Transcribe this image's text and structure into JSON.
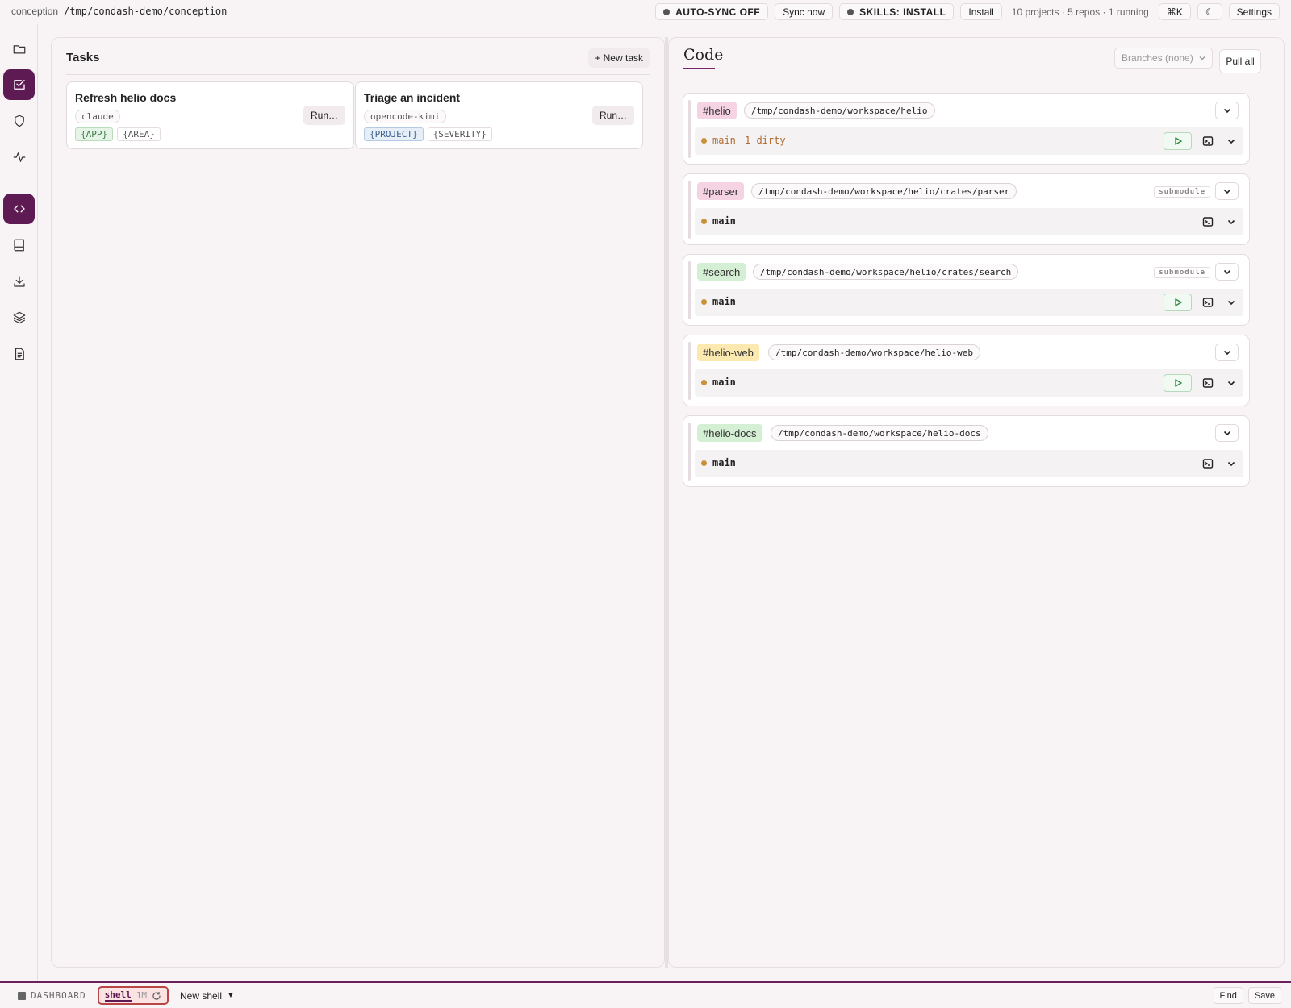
{
  "topbar": {
    "workspace_name": "conception",
    "workspace_path": "/tmp/condash-demo/conception",
    "auto_sync": "AUTO-SYNC OFF",
    "sync_now": "Sync now",
    "skills": "SKILLS: INSTALL",
    "install": "Install",
    "summary": "10 projects · 5 repos · 1 running",
    "shortcut": "⌘K",
    "theme_icon": "☾",
    "settings": "Settings"
  },
  "rail": {
    "items": [
      {
        "name": "folder-icon",
        "active": false
      },
      {
        "name": "tasks-icon",
        "active": true
      },
      {
        "name": "shield-icon",
        "active": false
      },
      {
        "name": "activity-icon",
        "active": false
      },
      {
        "name": "code-icon",
        "active": true
      },
      {
        "name": "book-icon",
        "active": false
      },
      {
        "name": "download-icon",
        "active": false
      },
      {
        "name": "layers-icon",
        "active": false
      },
      {
        "name": "document-icon",
        "active": false
      }
    ]
  },
  "tasks": {
    "title": "Tasks",
    "new_task": "+ New task",
    "cards": [
      {
        "title": "Refresh helio docs",
        "agent": "claude",
        "run": "Run…",
        "tags": [
          {
            "text": "{APP}",
            "style": "green"
          },
          {
            "text": "{AREA}",
            "style": "plain"
          }
        ]
      },
      {
        "title": "Triage an incident",
        "agent": "opencode-kimi",
        "run": "Run…",
        "tags": [
          {
            "text": "{PROJECT}",
            "style": "blue"
          },
          {
            "text": "{SEVERITY}",
            "style": "plain"
          }
        ]
      }
    ]
  },
  "code": {
    "title": "Code",
    "branches": "Branches (none)",
    "pull_all": "Pull all",
    "repos": [
      {
        "name": "#helio",
        "color": "#f6d3e2",
        "path": "/tmp/condash-demo/workspace/helio",
        "submodule": "",
        "branch": "main",
        "dirty": "1 dirty",
        "play": true
      },
      {
        "name": "#parser",
        "color": "#f6d3e2",
        "path": "/tmp/condash-demo/workspace/helio/crates/parser",
        "submodule": "submodule",
        "branch": "main",
        "dirty": "",
        "play": false
      },
      {
        "name": "#search",
        "color": "#d4efd4",
        "path": "/tmp/condash-demo/workspace/helio/crates/search",
        "submodule": "submodule",
        "branch": "main",
        "dirty": "",
        "play": true
      },
      {
        "name": "#helio-web",
        "color": "#fbe9b0",
        "path": "/tmp/condash-demo/workspace/helio-web",
        "submodule": "",
        "branch": "main",
        "dirty": "",
        "play": true
      },
      {
        "name": "#helio-docs",
        "color": "#d4efd4",
        "path": "/tmp/condash-demo/workspace/helio-docs",
        "submodule": "",
        "branch": "main",
        "dirty": "",
        "play": false
      }
    ]
  },
  "bottombar": {
    "dashboard": "DASHBOARD",
    "shell_name": "shell",
    "shell_age": "1M",
    "new_shell": "New shell",
    "find": "Find",
    "save": "Save"
  }
}
